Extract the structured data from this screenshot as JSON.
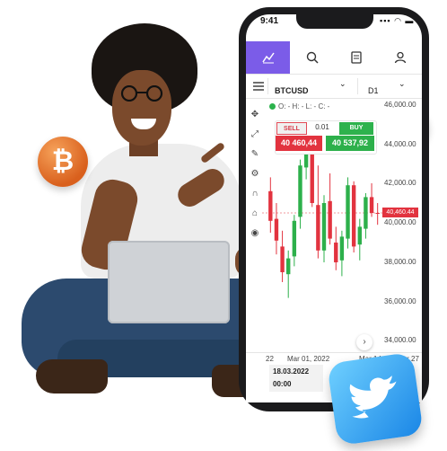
{
  "status_bar": {
    "time": "9:41",
    "icons": "▪▪▪ ◠ ▬"
  },
  "tabs": [
    {
      "name": "chart-tab",
      "icon": "chart-line-icon",
      "active": true
    },
    {
      "name": "search-tab",
      "icon": "magnifier-dollar-icon",
      "active": false
    },
    {
      "name": "orders-tab",
      "icon": "document-icon",
      "active": false
    },
    {
      "name": "profile-tab",
      "icon": "user-icon",
      "active": false
    }
  ],
  "symbol_bar": {
    "menu_icon": "hamburger-icon",
    "symbol": "BTCUSD",
    "symbol_chevron": "⌄",
    "timeframe": "D1",
    "timeframe_chevron": "⌄"
  },
  "ohlc": {
    "text": "O: - H: - L: - C: -"
  },
  "trade_panel": {
    "sell_label": "SELL",
    "spread": "0.01",
    "buy_label": "BUY",
    "sell_price": "40 460,44",
    "buy_price": "40 537,92"
  },
  "price_axis": {
    "labels": [
      "46,000.00",
      "44,000.00",
      "42,000.00",
      "40,000.00",
      "38,000.00",
      "36,000.00",
      "34,000.00"
    ]
  },
  "current_price_tag": "40,460.44",
  "date_axis": {
    "labels": [
      "22",
      "Mar 01, 2022",
      "Mar 14",
      "Mar 27"
    ]
  },
  "crosshair_tip": {
    "date": "18.03.2022",
    "time": "00:00"
  },
  "scroll_button": "›",
  "colors": {
    "accent": "#7b5ce8",
    "sell": "#e2333f",
    "buy": "#2db04b",
    "btc_coin": "#e86f25",
    "eth_coin": "#5b86f0",
    "twitter": "#1da1f2"
  },
  "chart_data": {
    "type": "candlestick",
    "ylim": [
      34000,
      46000
    ],
    "candles": [
      {
        "o": 41600,
        "h": 42300,
        "l": 39500,
        "c": 40100
      },
      {
        "o": 40200,
        "h": 41000,
        "l": 38400,
        "c": 39100
      },
      {
        "o": 38800,
        "h": 39600,
        "l": 37000,
        "c": 37500
      },
      {
        "o": 37400,
        "h": 38600,
        "l": 36200,
        "c": 38200
      },
      {
        "o": 38300,
        "h": 40400,
        "l": 37800,
        "c": 40100
      },
      {
        "o": 40300,
        "h": 43200,
        "l": 39700,
        "c": 42900
      },
      {
        "o": 42800,
        "h": 44700,
        "l": 42200,
        "c": 44300
      },
      {
        "o": 44100,
        "h": 44600,
        "l": 40800,
        "c": 41000
      },
      {
        "o": 40900,
        "h": 42900,
        "l": 38200,
        "c": 38600
      },
      {
        "o": 38600,
        "h": 41400,
        "l": 38000,
        "c": 41000
      },
      {
        "o": 41100,
        "h": 42500,
        "l": 38900,
        "c": 39200
      },
      {
        "o": 39000,
        "h": 39800,
        "l": 37600,
        "c": 38000
      },
      {
        "o": 38100,
        "h": 39600,
        "l": 37300,
        "c": 39300
      },
      {
        "o": 39200,
        "h": 42300,
        "l": 38700,
        "c": 41900
      },
      {
        "o": 41900,
        "h": 42100,
        "l": 38500,
        "c": 38800
      },
      {
        "o": 38900,
        "h": 40200,
        "l": 38100,
        "c": 39800
      },
      {
        "o": 39700,
        "h": 41500,
        "l": 39200,
        "c": 41300
      },
      {
        "o": 41300,
        "h": 42000,
        "l": 40300,
        "c": 40500
      },
      {
        "o": 40500,
        "h": 41000,
        "l": 39900,
        "c": 40460
      }
    ]
  }
}
